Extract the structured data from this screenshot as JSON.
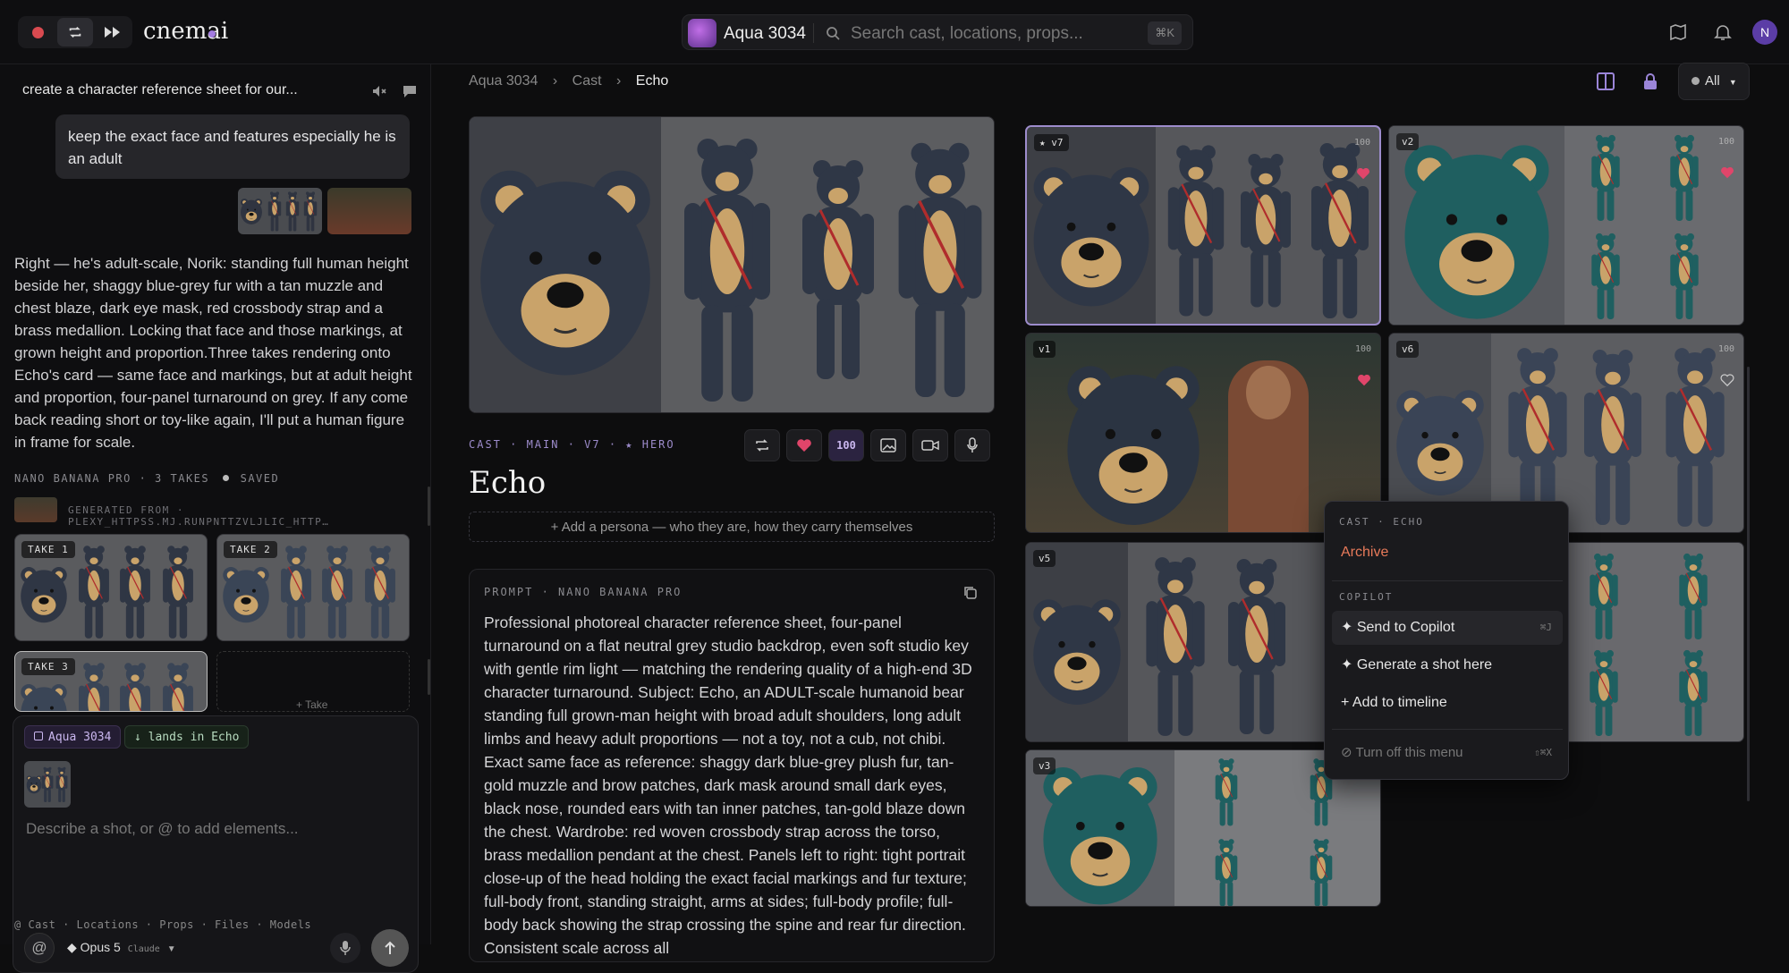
{
  "app": {
    "logo": "cnemai",
    "kbd": "⌘K",
    "avatar_initial": "N"
  },
  "project": {
    "name": "Aqua 3034",
    "search_placeholder": "Search cast, locations, props..."
  },
  "chat": {
    "title": "create a character reference sheet for our...",
    "user_message": "keep the exact face and features especially he is an adult",
    "assistant_message": "Right — he's adult-scale, Norik: standing full human height beside her, shaggy blue-grey fur with a tan muzzle and chest blaze, dark eye mask, red crossbody strap and a brass medallion. Locking that face and those markings, at grown height and proportion.Three takes rendering onto Echo's card — same face and markings, but at adult height and proportion, four-panel turnaround on grey. If any come back reading short or toy-like again, I'll put a human figure in frame for scale.",
    "gen_status": "NANO BANANA PRO · 3 TAKES",
    "gen_saved": "SAVED",
    "generated_from": "GENERATED FROM · PLEXY_HTTPSS.MJ.RUNPNTTZVLJLIC_HTTP…",
    "takes": [
      "TAKE 1",
      "TAKE 2",
      "TAKE 3"
    ],
    "add_take": "+ Take"
  },
  "composer": {
    "chip_project": "Aqua 3034",
    "chip_lands": "lands in Echo",
    "placeholder": "Describe a shot, or @ to add elements...",
    "model": "Opus 5",
    "model_sub": "Claude"
  },
  "footer_links": "@ Cast · Locations · Props · Files · Models",
  "breadcrumb": {
    "project": "Aqua 3034",
    "section": "Cast",
    "current": "Echo"
  },
  "header_controls": {
    "filter": "All"
  },
  "detail": {
    "meta": "CAST · MAIN · V7 · ★ HERO",
    "score": "100",
    "title": "Echo",
    "persona_placeholder": "+ Add a persona — who they are, how they carry themselves",
    "prompt_label": "PROMPT · NANO BANANA PRO",
    "prompt_text": "Professional photoreal character reference sheet, four-panel turnaround on a flat neutral grey studio backdrop, even soft studio key with gentle rim light — matching the rendering quality of a high-end 3D character turnaround. Subject: Echo, an ADULT-scale humanoid bear standing full grown-man height with broad adult shoulders, long adult limbs and heavy adult proportions — not a toy, not a cub, not chibi. Exact same face as reference: shaggy dark blue-grey plush fur, tan-gold muzzle and brow patches, dark mask around small dark eyes, black nose, rounded ears with tan inner patches, tan-gold blaze down the chest. Wardrobe: red woven crossbody strap across the torso, brass medallion pendant at the chest. Panels left to right: tight portrait close-up of the head holding the exact facial markings and fur texture; full-body front, standing straight, arms at sides; full-body profile; full-body back showing the strap crossing the spine and rear fur direction. Consistent scale across all"
  },
  "versions": [
    {
      "label": "★ v7",
      "num": "100"
    },
    {
      "label": "v2",
      "num": "100"
    },
    {
      "label": "v1",
      "num": "100"
    },
    {
      "label": "v6",
      "num": "100"
    },
    {
      "label": "v5",
      "num": ""
    },
    {
      "label": "v3",
      "num": ""
    }
  ],
  "context_menu": {
    "section1": "CAST · ECHO",
    "archive": "Archive",
    "section2": "COPILOT",
    "send": "✦ Send to Copilot",
    "send_kbd": "⌘J",
    "generate": "✦ Generate a shot here",
    "timeline": "+ Add to timeline",
    "turn_off": "⊘ Turn off this menu",
    "turn_off_kbd": "⇧⌘X"
  },
  "colors": {
    "accent": "#a27be0",
    "heart": "#e0456a",
    "record": "#d94a50"
  }
}
